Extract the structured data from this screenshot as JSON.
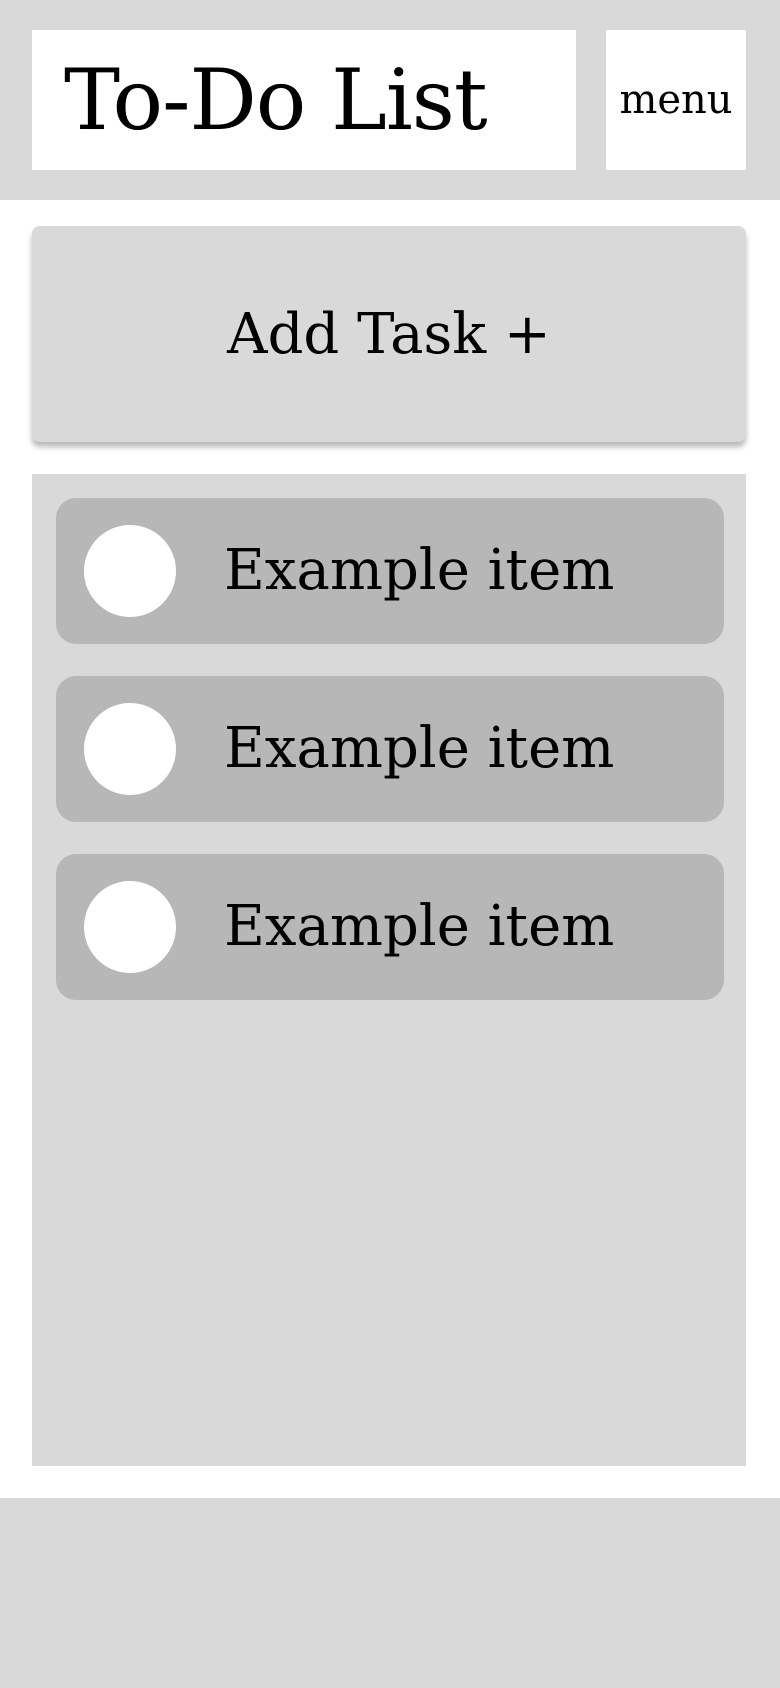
{
  "header": {
    "title": "To-Do List",
    "menu_label": "menu"
  },
  "add_task": {
    "label": "Add Task +"
  },
  "tasks": [
    {
      "label": "Example item",
      "done": false
    },
    {
      "label": "Example item",
      "done": false
    },
    {
      "label": "Example item",
      "done": false
    }
  ],
  "colors": {
    "panel_gray": "#d9d9d9",
    "item_gray": "#b7b7b7",
    "surface_white": "#ffffff"
  }
}
